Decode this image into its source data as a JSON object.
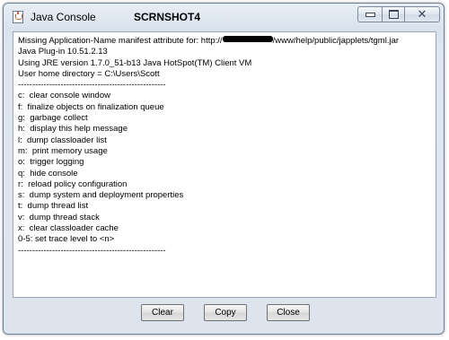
{
  "window": {
    "title": "Java Console",
    "label": "SCRNSHOT4",
    "controls": {
      "minimize": "minimize",
      "maximize": "maximize",
      "close": "close"
    }
  },
  "console": {
    "lines": [
      {
        "before": "Missing Application-Name manifest attribute for: http://",
        "after": "/www/help/public/japplets/tgml.jar",
        "redacted": true
      },
      {
        "text": "Java Plug-in 10.51.2.13"
      },
      {
        "text": "Using JRE version 1.7.0_51-b13 Java HotSpot(TM) Client VM"
      },
      {
        "text": "User home directory = C:\\Users\\Scott"
      },
      {
        "text": "----------------------------------------------------"
      },
      {
        "text": "c:  clear console window"
      },
      {
        "text": "f:  finalize objects on finalization queue"
      },
      {
        "text": "g:  garbage collect"
      },
      {
        "text": "h:  display this help message"
      },
      {
        "text": "l:  dump classloader list"
      },
      {
        "text": "m:  print memory usage"
      },
      {
        "text": "o:  trigger logging"
      },
      {
        "text": "q:  hide console"
      },
      {
        "text": "r:  reload policy configuration"
      },
      {
        "text": "s:  dump system and deployment properties"
      },
      {
        "text": "t:  dump thread list"
      },
      {
        "text": "v:  dump thread stack"
      },
      {
        "text": "x:  clear classloader cache"
      },
      {
        "text": "0-5: set trace level to <n>"
      },
      {
        "text": "----------------------------------------------------"
      }
    ]
  },
  "buttons": {
    "clear": "Clear",
    "copy": "Copy",
    "close": "Close"
  }
}
